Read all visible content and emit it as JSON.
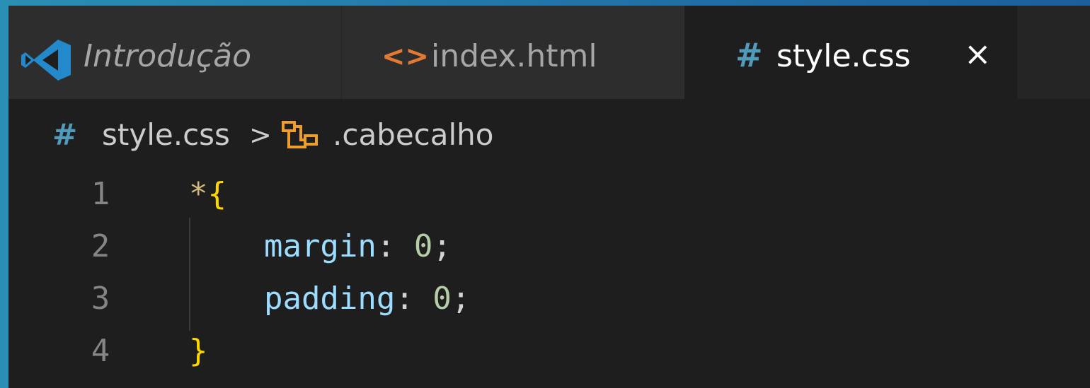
{
  "tabs": [
    {
      "label": "Introdução",
      "icon": "vscode-logo-icon",
      "active": false
    },
    {
      "label": "index.html",
      "icon": "html-file-icon",
      "active": false
    },
    {
      "label": "style.css",
      "icon": "css-hash-icon",
      "active": true
    }
  ],
  "close_glyph": "×",
  "breadcrumb": {
    "file": "style.css",
    "separator": ">",
    "symbol": ".cabecalho"
  },
  "code": {
    "lines": [
      {
        "num": "1",
        "tokens": [
          [
            "sel",
            "*"
          ],
          [
            "brace",
            "{"
          ]
        ]
      },
      {
        "num": "2",
        "tokens": [
          [
            "prop",
            "    margin"
          ],
          [
            "punc",
            ": "
          ],
          [
            "num",
            "0"
          ],
          [
            "punc",
            ";"
          ]
        ]
      },
      {
        "num": "3",
        "tokens": [
          [
            "prop",
            "    padding"
          ],
          [
            "punc",
            ": "
          ],
          [
            "num",
            "0"
          ],
          [
            "punc",
            ";"
          ]
        ]
      },
      {
        "num": "4",
        "tokens": [
          [
            "brace",
            "}"
          ]
        ]
      }
    ]
  },
  "colors": {
    "editor_bg": "#1e1e1e",
    "tab_inactive_bg": "#2d2d2d",
    "css_icon": "#519aba",
    "html_icon": "#e37933",
    "vscode_blue": "#2489ca"
  }
}
